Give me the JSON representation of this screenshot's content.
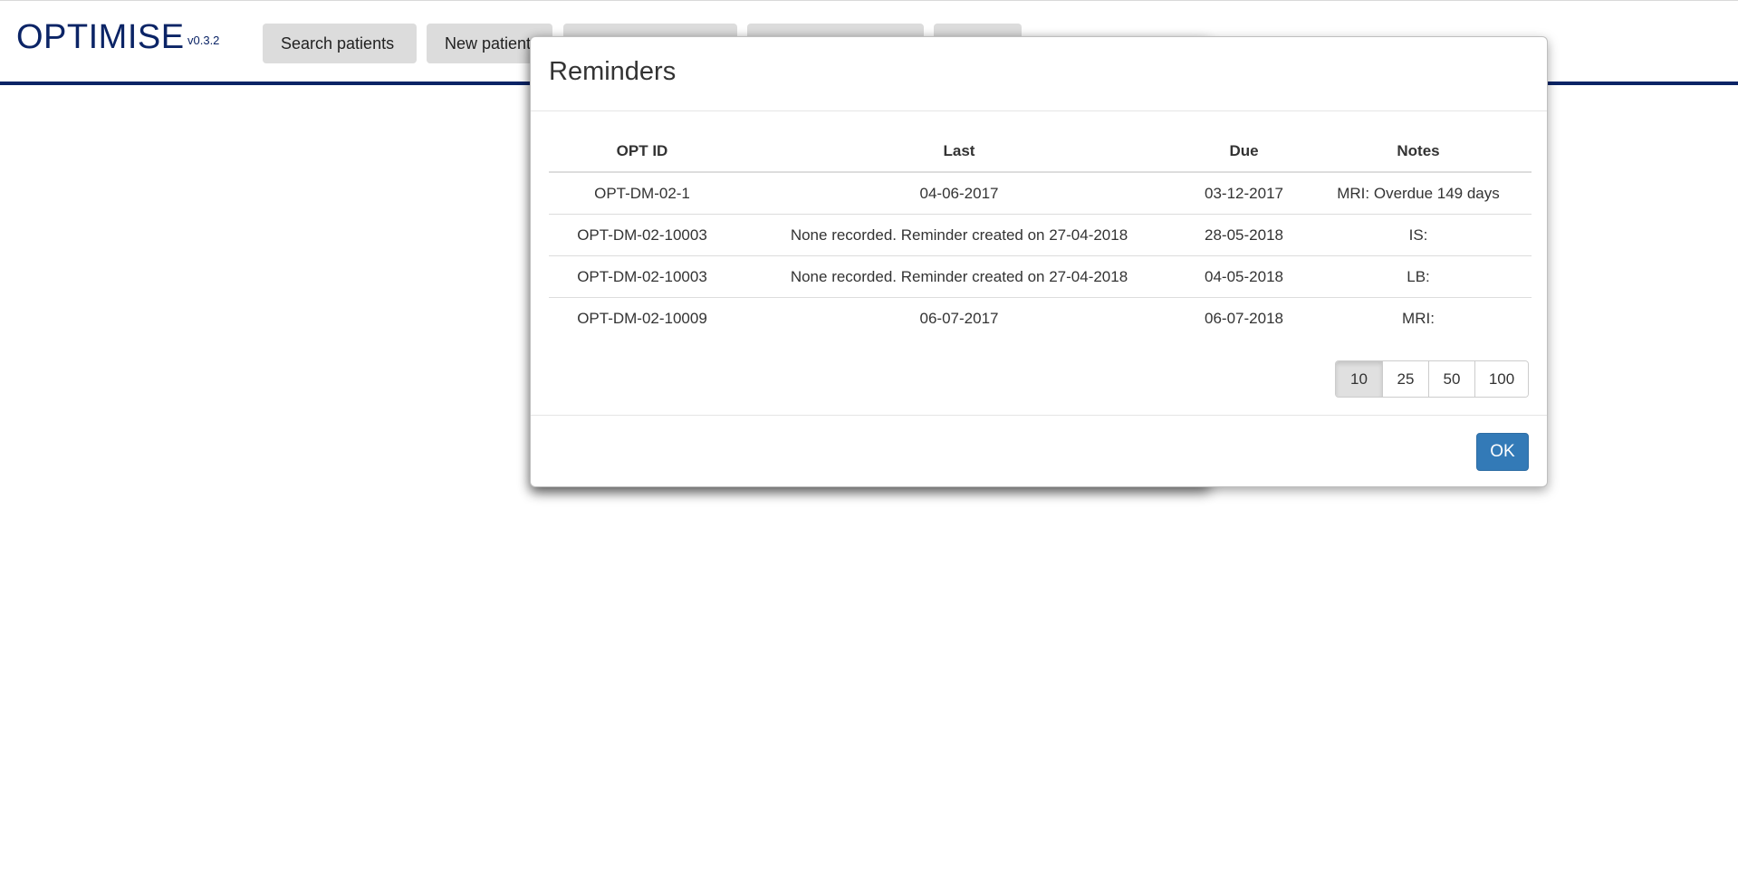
{
  "app": {
    "brand": "OPTIMISE",
    "version": "v0.3.2"
  },
  "nav": {
    "items": [
      {
        "label": "Search patients"
      },
      {
        "label": "New patient"
      },
      {
        "label": ""
      },
      {
        "label": ""
      },
      {
        "label": ""
      }
    ]
  },
  "colors": {
    "brand": "#0b2466",
    "primary_button": "#337ab7",
    "nav_button": "#dcdcdc"
  },
  "modal": {
    "title": "Reminders",
    "table": {
      "headers": [
        "OPT ID",
        "Last",
        "Due",
        "Notes"
      ],
      "rows": [
        {
          "opt_id": "OPT-DM-02-1",
          "last": "04-06-2017",
          "due": "03-12-2017",
          "notes": "MRI: Overdue 149 days"
        },
        {
          "opt_id": "OPT-DM-02-10003",
          "last": "None recorded. Reminder created on 27-04-2018",
          "due": "28-05-2018",
          "notes": "IS:"
        },
        {
          "opt_id": "OPT-DM-02-10003",
          "last": "None recorded. Reminder created on 27-04-2018",
          "due": "04-05-2018",
          "notes": "LB:"
        },
        {
          "opt_id": "OPT-DM-02-10009",
          "last": "06-07-2017",
          "due": "06-07-2018",
          "notes": "MRI:"
        }
      ]
    },
    "page_size": {
      "options": [
        "10",
        "25",
        "50",
        "100"
      ],
      "selected": "10"
    },
    "ok_label": "OK"
  }
}
